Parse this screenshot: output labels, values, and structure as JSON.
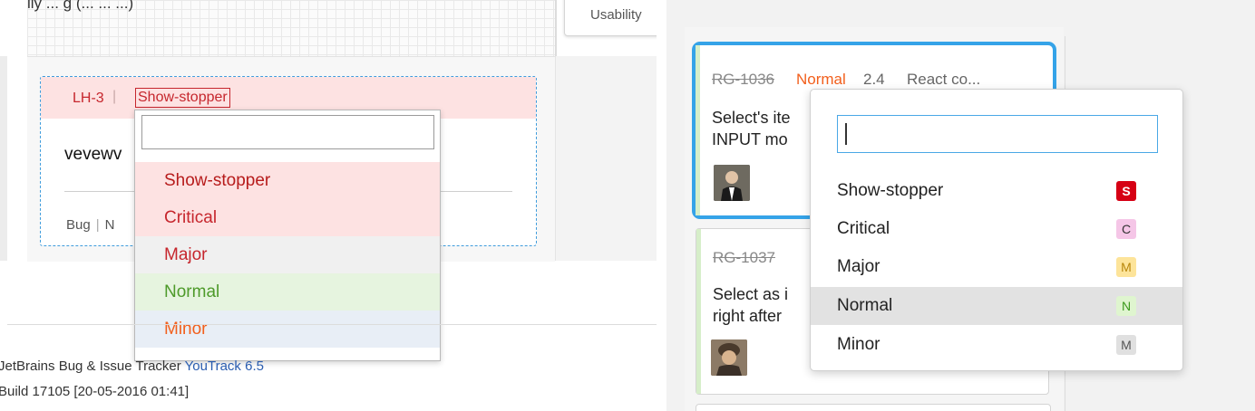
{
  "left": {
    "top_text": "ily ... g (... ... ...)",
    "usability_label": "Usability",
    "card": {
      "id": "LH-3",
      "separator": "|",
      "priority": "Show-stopper",
      "summary": "vevewv",
      "type_label": "Bug",
      "type_sep": "|",
      "state_label": "N"
    },
    "dropdown": {
      "search_value": "",
      "options": [
        "Show-stopper",
        "Critical",
        "Major",
        "Normal",
        "Minor"
      ]
    },
    "footer": {
      "line1_prefix": "JetBrains Bug & Issue Tracker",
      "line1_product": "YouTrack 6.5",
      "line2": "Build 17105 [20-05-2016 01:41]"
    }
  },
  "right": {
    "card1": {
      "id": "RG-1036",
      "priority": "Normal",
      "version": "2.4",
      "subsystem": "React co...",
      "summary_line1": "Select's ite",
      "summary_line2": "INPUT mo"
    },
    "card2": {
      "id": "RG-1037",
      "summary_line1": "Select as i",
      "summary_line2": "right after"
    },
    "dropdown": {
      "search_value": "",
      "options": [
        {
          "label": "Show-stopper",
          "badge": "S",
          "color": "#d60014"
        },
        {
          "label": "Critical",
          "badge": "C",
          "color": "#f5c6e7"
        },
        {
          "label": "Major",
          "badge": "M",
          "color": "#fde49a"
        },
        {
          "label": "Normal",
          "badge": "N",
          "color": "#dff5cf"
        },
        {
          "label": "Minor",
          "badge": "M",
          "color": "#e0e0e0"
        }
      ],
      "highlighted": "Normal"
    }
  }
}
